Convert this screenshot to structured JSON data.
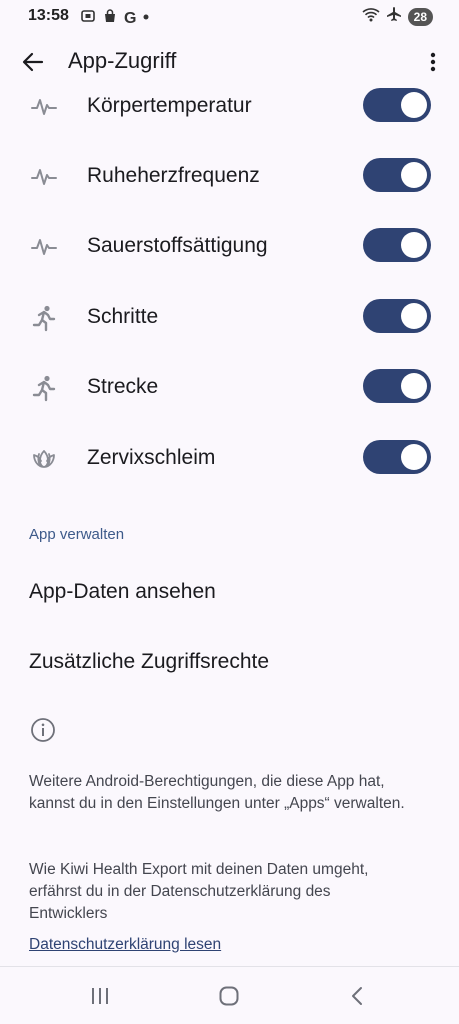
{
  "status": {
    "time": "13:58",
    "left_icons": [
      "screenshot-icon",
      "bag-icon",
      "google-g-icon",
      "dot-icon"
    ],
    "google_letter": "G",
    "battery": "28"
  },
  "appbar": {
    "title": "App-Zugriff"
  },
  "permissions": [
    {
      "label": "Körpertemperatur",
      "icon": "vitals-icon",
      "enabled": true
    },
    {
      "label": "Ruheherzfrequenz",
      "icon": "vitals-icon",
      "enabled": true
    },
    {
      "label": "Sauerstoffsättigung",
      "icon": "vitals-icon",
      "enabled": true
    },
    {
      "label": "Schritte",
      "icon": "running-icon",
      "enabled": true
    },
    {
      "label": "Strecke",
      "icon": "running-icon",
      "enabled": true
    },
    {
      "label": "Zervixschleim",
      "icon": "lotus-icon",
      "enabled": true
    }
  ],
  "manage": {
    "header": "App verwalten",
    "view_data": "App-Daten ansehen",
    "extra_permissions": "Zusätzliche Zugriffsrechte"
  },
  "info": {
    "text1": "Weitere Android-Berechtigungen, die diese App hat, kannst du in den Einstellungen unter „Apps“ verwalten.",
    "text2": "Wie Kiwi Health Export mit deinen Daten umgeht, erfährst du in der Datenschutzerklärung des Entwicklers",
    "link": "Datenschutzerklärung lesen"
  },
  "colors": {
    "toggle_on": "#2f4373",
    "accent": "#3d5a8a",
    "background": "#fbf8fd"
  }
}
